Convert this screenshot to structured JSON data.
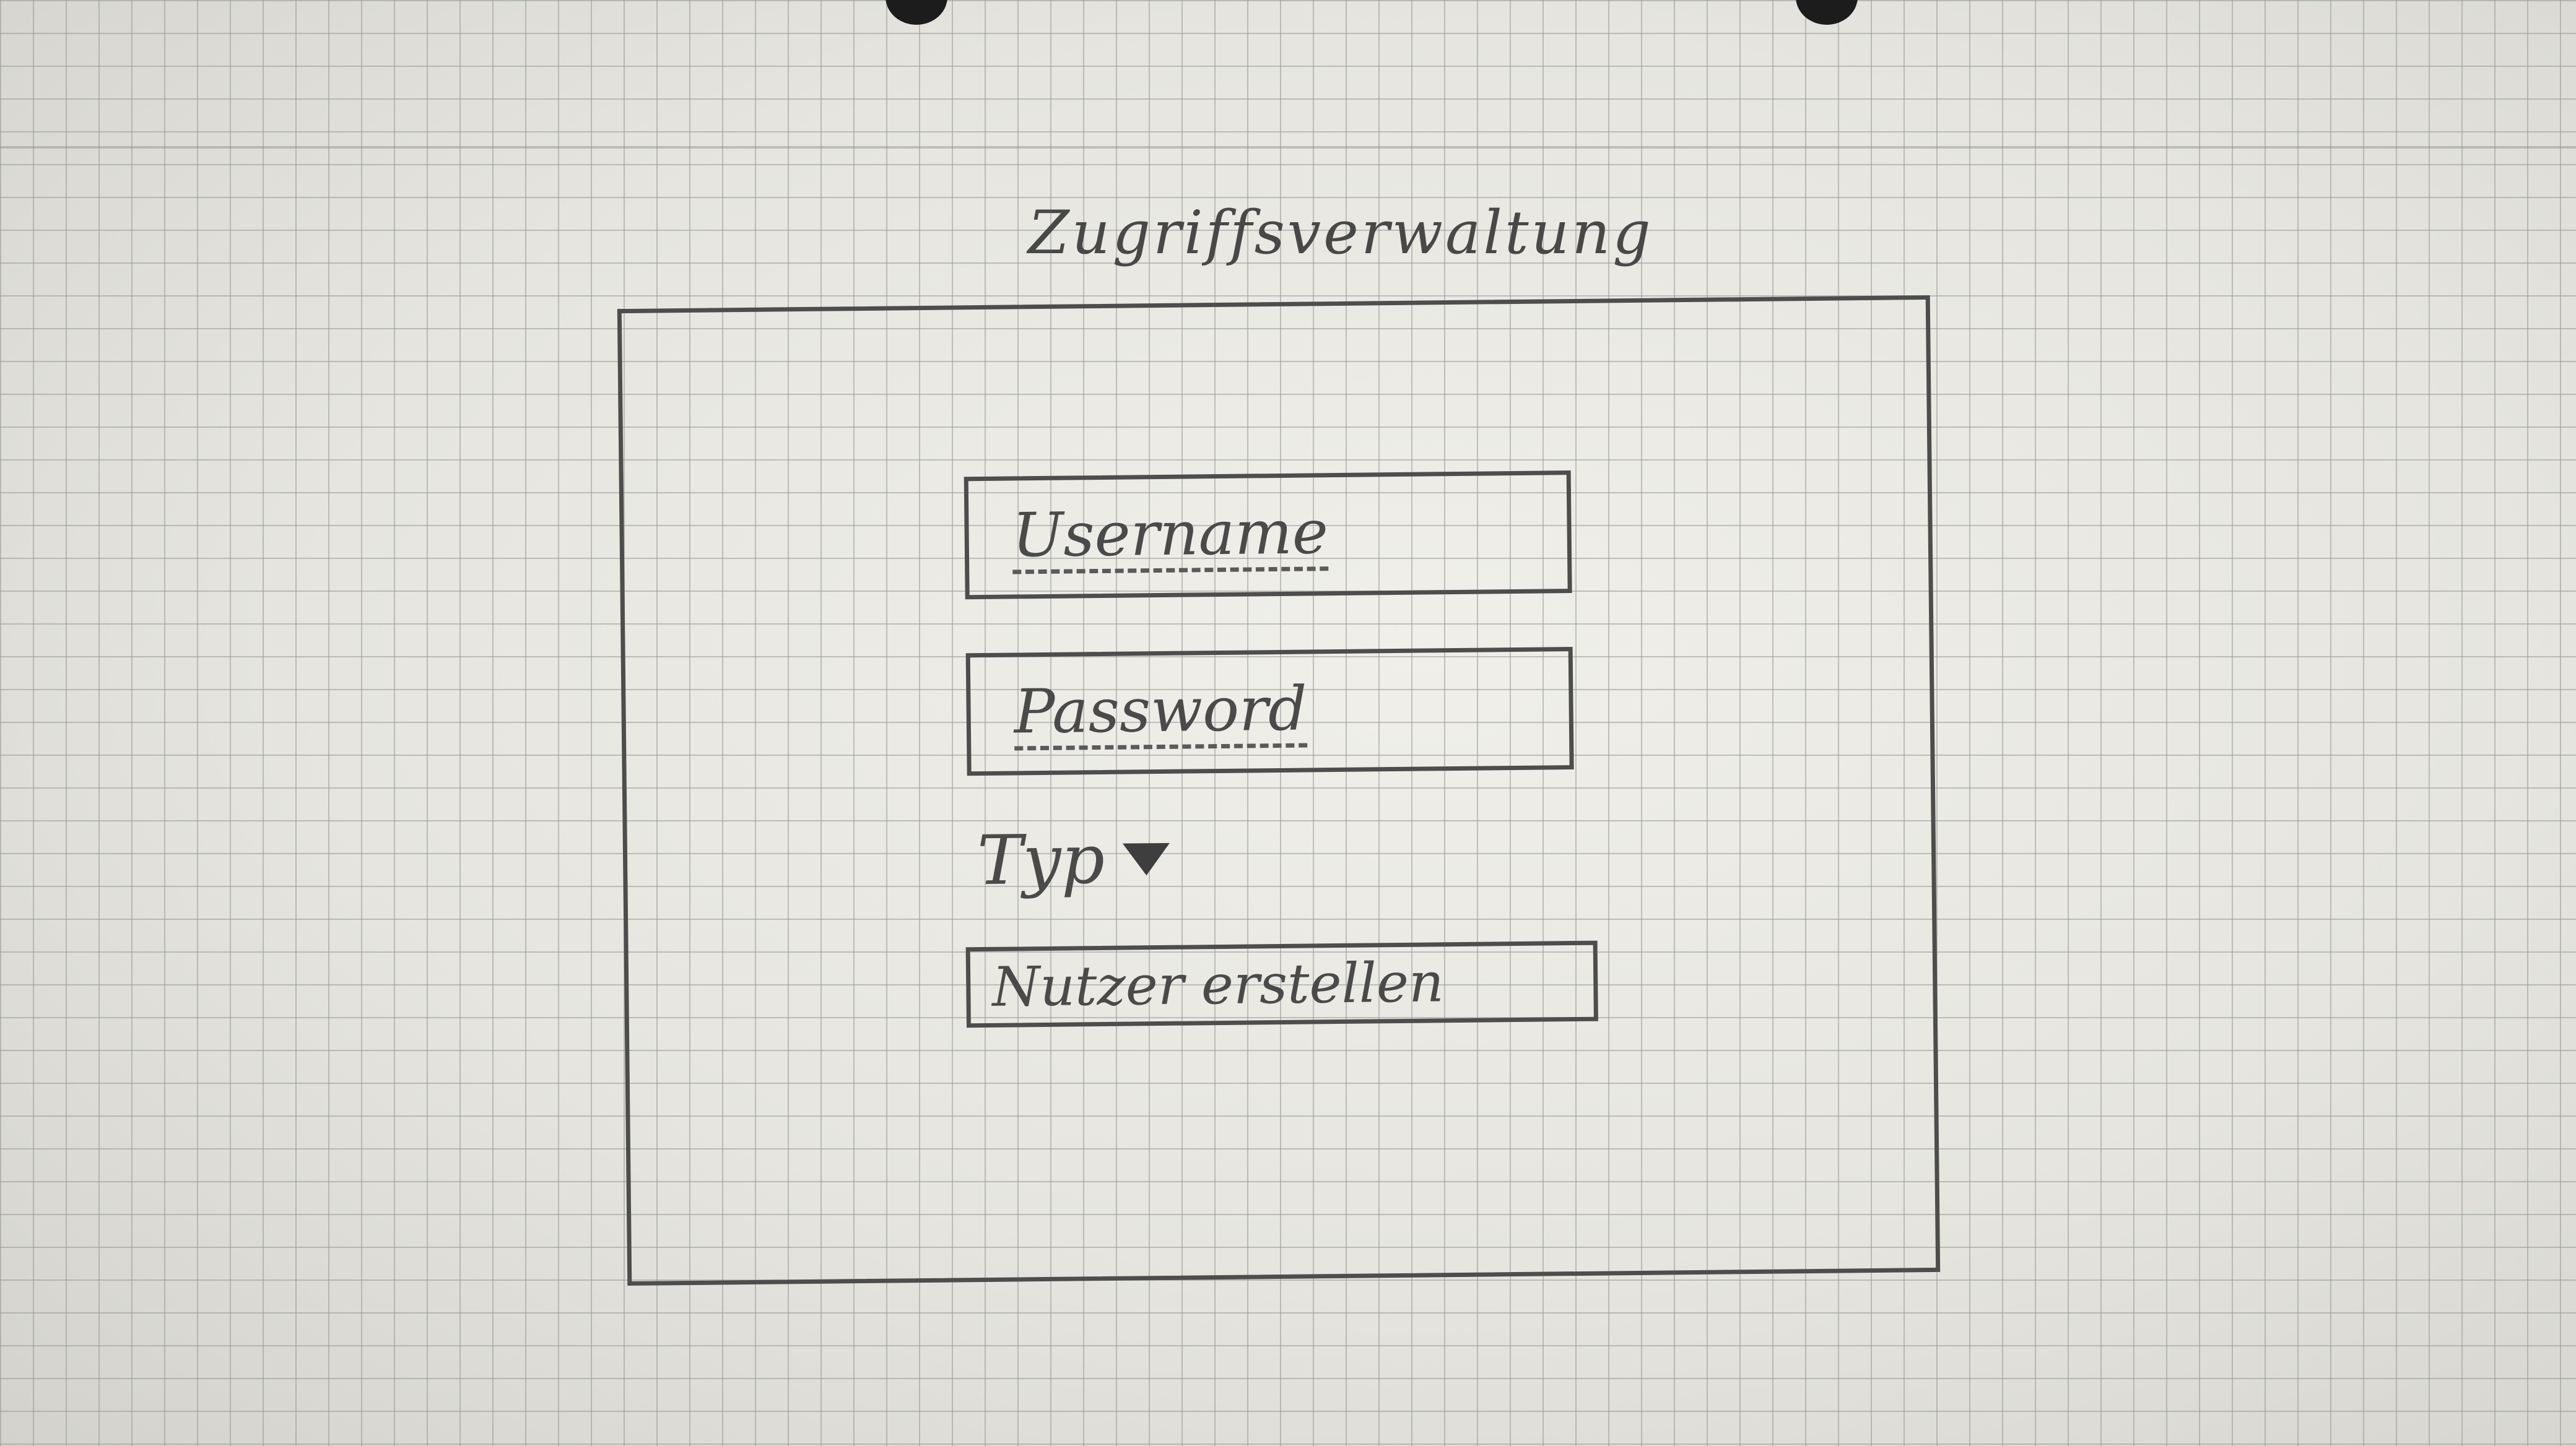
{
  "title": "Zugriffsverwaltung",
  "form": {
    "username_placeholder": "Username",
    "password_placeholder": "Password",
    "type_label": "Typ",
    "submit_label": "Nutzer erstellen"
  }
}
